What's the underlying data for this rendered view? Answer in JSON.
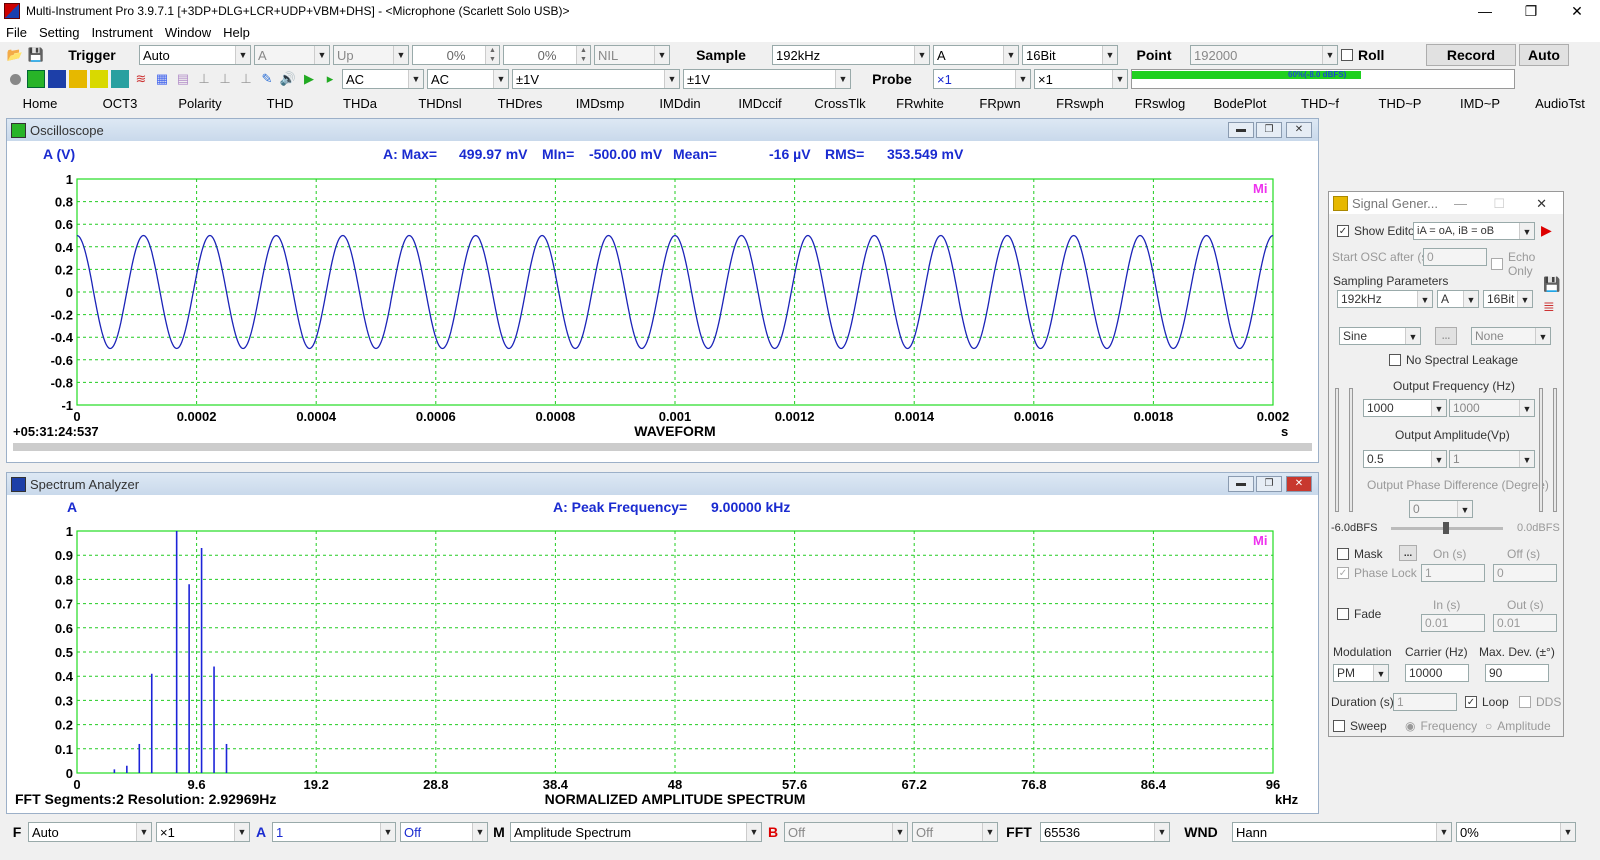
{
  "titlebar": {
    "title": "Multi-Instrument Pro 3.9.7.1    [+3DP+DLG+LCR+UDP+VBM+DHS]   -   <Microphone (Scarlett Solo USB)>",
    "min": "—",
    "restore": "❐",
    "close": "✕"
  },
  "menu": [
    "File",
    "Setting",
    "Instrument",
    "Window",
    "Help"
  ],
  "toolbar1": {
    "trigger_label": "Trigger",
    "trigger_mode": "Auto",
    "trigger_channel": "A",
    "trigger_edge": "Up",
    "level1": "0%",
    "level2": "0%",
    "nil": "NIL",
    "sample_label": "Sample",
    "sample_rate": "192kHz",
    "sample_channel": "A",
    "bits": "16Bit",
    "point_label": "Point",
    "points": "192000",
    "roll_label": "Roll",
    "record_label": "Record",
    "auto_label": "Auto"
  },
  "toolbar2": {
    "coupling_a": "AC",
    "coupling_b": "AC",
    "range_a": "±1V",
    "range_b": "±1V",
    "probe_label": "Probe",
    "probe_a": "×1",
    "probe_b": "×1",
    "meter_text": "60%(-8.0 dBFS)",
    "meter_level": 0.6
  },
  "tabs": [
    "Home",
    "OCT3",
    "Polarity",
    "THD",
    "THDa",
    "THDnsl",
    "THDres",
    "IMDsmp",
    "IMDdin",
    "IMDccif",
    "CrossTlk",
    "FRwhite",
    "FRpwn",
    "FRswph",
    "FRswlog",
    "BodePlot",
    "THD~f",
    "THD~P",
    "IMD~P",
    "AudioTst"
  ],
  "osc": {
    "title": "Oscilloscope",
    "ylabel": "A (V)",
    "stats": {
      "max_label": "A: Max=",
      "max": "499.97 mV",
      "min_label": "MIn=",
      "min": "-500.00 mV",
      "mean_label": "Mean=",
      "mean": "-16  µV",
      "rms_label": "RMS=",
      "rms": "353.549 mV"
    },
    "timestamp": "+05:31:24:537",
    "caption": "WAVEFORM",
    "unit": "s",
    "logo": "Mi"
  },
  "spec": {
    "title": "Spectrum Analyzer",
    "ylabel": "A",
    "peak_label": "A: Peak Frequency=",
    "peak": "9.00000  kHz",
    "fft_info": "FFT Segments:2   Resolution: 2.92969Hz",
    "caption": "NORMALIZED AMPLITUDE SPECTRUM",
    "unit": "kHz",
    "logo": "Mi"
  },
  "chart_data": [
    {
      "type": "line",
      "title": "WAVEFORM",
      "xlabel": "s",
      "ylabel": "A (V)",
      "xlim": [
        0,
        0.002
      ],
      "ylim": [
        -1,
        1
      ],
      "xticks": [
        "0",
        "0.0002",
        "0.0004",
        "0.0006",
        "0.0008",
        "0.001",
        "0.0012",
        "0.0014",
        "0.0016",
        "0.0018",
        "0.002"
      ],
      "yticks": [
        "1",
        "0.8",
        "0.6",
        "0.4",
        "0.2",
        "0",
        "-0.2",
        "-0.4",
        "-0.6",
        "-0.8",
        "-1"
      ],
      "series": [
        {
          "color": "#1c24b8",
          "amplitude": 0.5,
          "frequency_hz": 9000,
          "phase": "cos"
        }
      ]
    },
    {
      "type": "bar",
      "title": "NORMALIZED AMPLITUDE SPECTRUM",
      "xlabel": "kHz",
      "ylabel": "A",
      "xlim": [
        0,
        96
      ],
      "ylim": [
        0,
        1
      ],
      "xticks": [
        "0",
        "9.6",
        "19.2",
        "28.8",
        "38.4",
        "48",
        "57.6",
        "67.2",
        "76.8",
        "86.4",
        "96"
      ],
      "yticks": [
        "1",
        "0.9",
        "0.8",
        "0.7",
        "0.6",
        "0.5",
        "0.4",
        "0.3",
        "0.2",
        "0.1",
        "0"
      ],
      "x": [
        3,
        4,
        5,
        6,
        7,
        8,
        9,
        10,
        11,
        12
      ],
      "values": [
        0.015,
        0.03,
        0.12,
        0.41,
        0.0,
        1.0,
        0.78,
        0.93,
        0.44,
        0.12
      ]
    }
  ],
  "siggen": {
    "title": "Signal Gener...",
    "show_editor": "Show Editor",
    "expr": "iA = oA, iB = oB",
    "start_osc": "Start OSC after (s)",
    "start_val": "0",
    "echo_only": "Echo Only",
    "sampling_params": "Sampling Parameters",
    "rate": "192kHz",
    "channel": "A",
    "bits": "16Bit",
    "waveform": "Sine",
    "browse": "...",
    "none": "None",
    "no_leakage": "No Spectral Leakage",
    "out_freq_label": "Output Frequency (Hz)",
    "freq_a": "1000",
    "freq_b": "1000",
    "out_amp_label": "Output Amplitude(Vp)",
    "amp_a": "0.5",
    "amp_b": "1",
    "phase_label": "Output Phase Difference (Degree)",
    "phase": "0",
    "dbfs_left": "-6.0dBFS",
    "dbfs_right": "0.0dBFS",
    "mask": "Mask",
    "mask_btn": "...",
    "on_s": "On (s)",
    "off_s": "Off (s)",
    "phase_lock": "Phase Lock",
    "on_val": "1",
    "off_val": "0",
    "fade": "Fade",
    "in_s": "In (s)",
    "out_s": "Out (s)",
    "in_val": "0.01",
    "out_val": "0.01",
    "modulation": "Modulation",
    "carrier": "Carrier (Hz)",
    "maxdev": "Max. Dev. (±°)",
    "mod_type": "PM",
    "carrier_val": "10000",
    "maxdev_val": "90",
    "duration": "Duration (s)",
    "duration_val": "1",
    "loop": "Loop",
    "dds": "DDS",
    "sweep": "Sweep",
    "frequency": "Frequency",
    "amplitude": "Amplitude"
  },
  "statusbar": {
    "f_label": "F",
    "mode": "Auto",
    "mult": "×1",
    "a_label": "A",
    "a_val": "1",
    "a_off": "Off",
    "m_label": "M",
    "m_val": "Amplitude Spectrum",
    "b_label": "B",
    "b_val": "Off",
    "b_off": "Off",
    "fft_label": "FFT",
    "fft_val": "65536",
    "wnd_label": "WND",
    "wnd_val": "Hann",
    "pct": "0%"
  }
}
